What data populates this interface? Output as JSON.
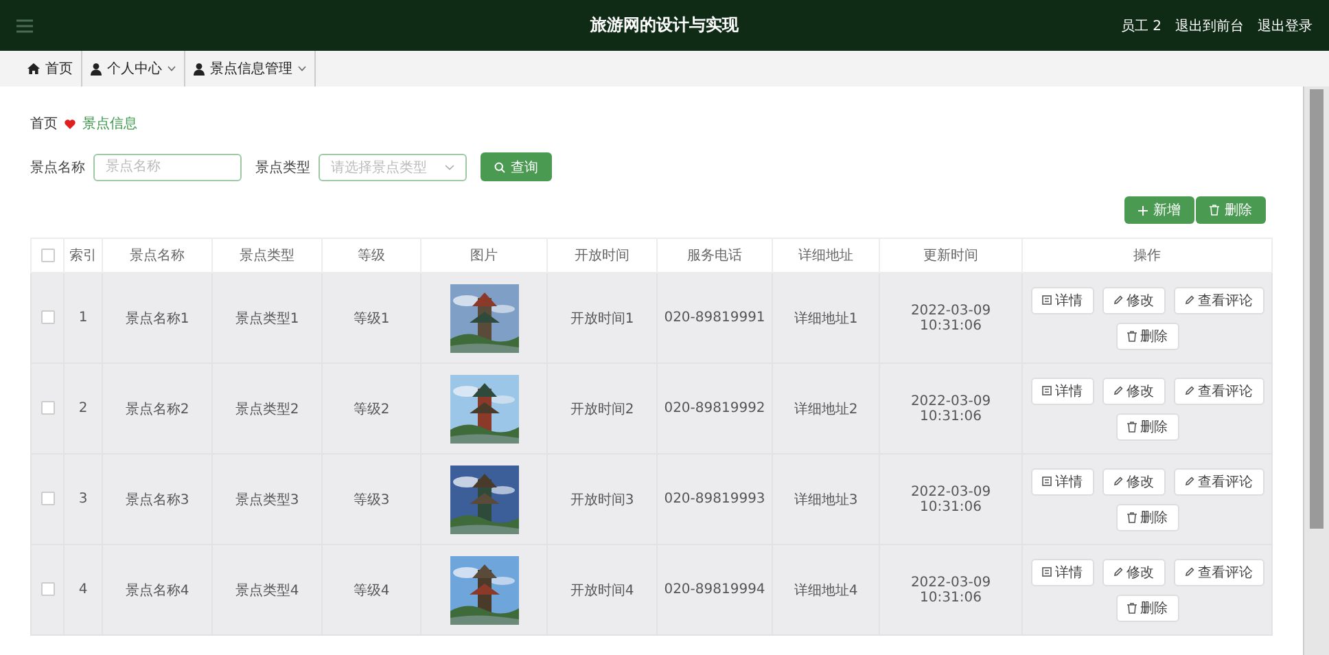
{
  "topbar": {
    "title": "旅游网的设计与实现",
    "user": "员工 2",
    "links": [
      "退出到前台",
      "退出登录"
    ]
  },
  "nav": [
    {
      "label": "首页",
      "kind": "home",
      "dropdown": false
    },
    {
      "label": "个人中心",
      "kind": "user",
      "dropdown": true
    },
    {
      "label": "景点信息管理",
      "kind": "user",
      "dropdown": true
    }
  ],
  "breadcrumb": [
    "首页",
    "景点信息"
  ],
  "search": {
    "fields": [
      {
        "label": "景点名称",
        "kind": "input",
        "placeholder": "景点名称"
      },
      {
        "label": "景点类型",
        "kind": "select",
        "placeholder": "请选择景点类型"
      }
    ],
    "button": "查询"
  },
  "toolbar": [
    {
      "label": "新增",
      "kind": "add"
    },
    {
      "label": "删除",
      "kind": "delete"
    }
  ],
  "table": {
    "select_all": {
      "checked": false
    },
    "columns": [
      "索引",
      "景点名称",
      "景点类型",
      "等级",
      "图片",
      "开放时间",
      "服务电话",
      "详细地址",
      "更新时间",
      "操作"
    ],
    "rows": [
      {
        "checked": false,
        "cells": [
          "1",
          "景点名称1",
          "景点类型1",
          "等级1",
          {
            "kind": "picture"
          },
          "开放时间1",
          "020-89819991",
          "详细地址1",
          "2022-03-09 10:31:06"
        ],
        "actions": [
          {
            "label": "详情",
            "kind": "detail"
          },
          {
            "label": "修改",
            "kind": "edit"
          },
          {
            "label": "查看评论",
            "kind": "edit"
          },
          {
            "label": "删除",
            "kind": "delete"
          }
        ]
      },
      {
        "checked": false,
        "cells": [
          "2",
          "景点名称2",
          "景点类型2",
          "等级2",
          {
            "kind": "picture"
          },
          "开放时间2",
          "020-89819992",
          "详细地址2",
          "2022-03-09 10:31:06"
        ],
        "actions": [
          {
            "label": "详情",
            "kind": "detail"
          },
          {
            "label": "修改",
            "kind": "edit"
          },
          {
            "label": "查看评论",
            "kind": "edit"
          },
          {
            "label": "删除",
            "kind": "delete"
          }
        ]
      },
      {
        "checked": false,
        "cells": [
          "3",
          "景点名称3",
          "景点类型3",
          "等级3",
          {
            "kind": "picture"
          },
          "开放时间3",
          "020-89819993",
          "详细地址3",
          "2022-03-09 10:31:06"
        ],
        "actions": [
          {
            "label": "详情",
            "kind": "detail"
          },
          {
            "label": "修改",
            "kind": "edit"
          },
          {
            "label": "查看评论",
            "kind": "edit"
          },
          {
            "label": "删除",
            "kind": "delete"
          }
        ]
      },
      {
        "checked": false,
        "cells": [
          "4",
          "景点名称4",
          "景点类型4",
          "等级4",
          {
            "kind": "picture"
          },
          "开放时间4",
          "020-89819994",
          "详细地址4",
          "2022-03-09 10:31:06"
        ],
        "actions": [
          {
            "label": "详情",
            "kind": "detail"
          },
          {
            "label": "修改",
            "kind": "edit"
          },
          {
            "label": "查看评论",
            "kind": "edit"
          },
          {
            "label": "删除",
            "kind": "delete"
          }
        ]
      }
    ]
  }
}
